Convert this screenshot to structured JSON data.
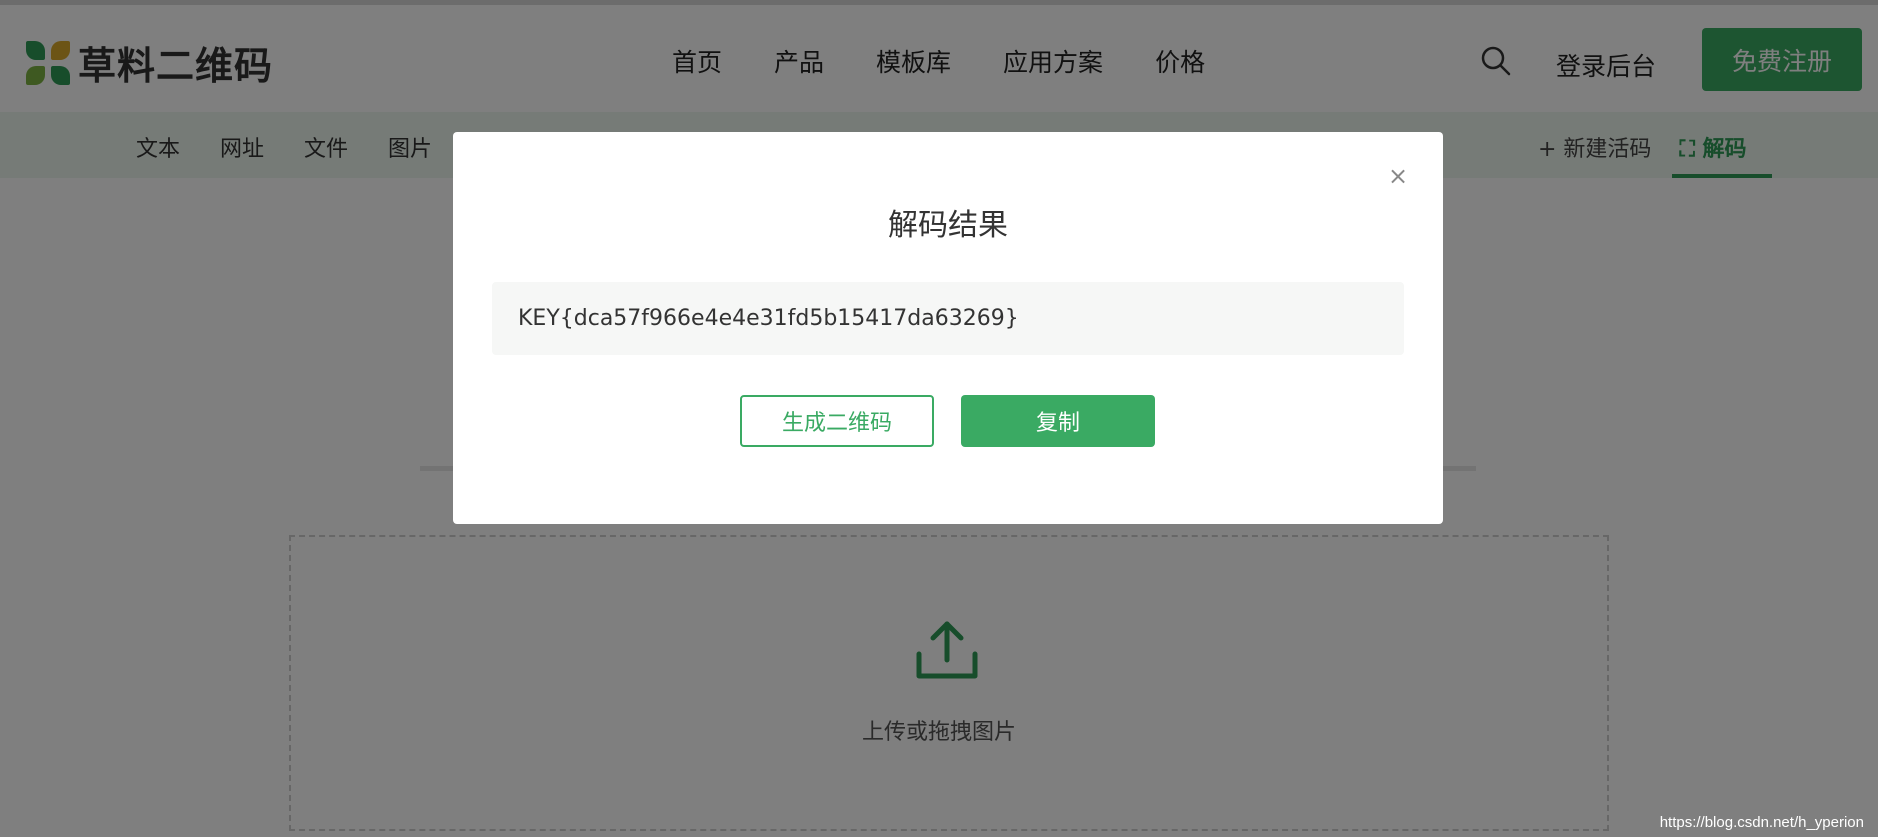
{
  "header": {
    "logo_text": "草料二维码",
    "nav": [
      "首页",
      "产品",
      "模板库",
      "应用方案",
      "价格"
    ],
    "login": "登录后台",
    "register": "免费注册"
  },
  "subnav": {
    "tabs": [
      "文本",
      "网址",
      "文件",
      "图片"
    ],
    "new_live": "+ 新建活码",
    "decode": "解码"
  },
  "upload": {
    "text": "上传或拖拽图片"
  },
  "modal": {
    "close": "×",
    "title": "解码结果",
    "result": "KEY{dca57f966e4e4e31fd5b15417da63269}",
    "generate_label": "生成二维码",
    "copy_label": "复制"
  },
  "watermark": "https://blog.csdn.net/h_yperion",
  "colors": {
    "brand_green": "#3aaa63",
    "overlay": "rgba(0,0,0,0.5)"
  }
}
